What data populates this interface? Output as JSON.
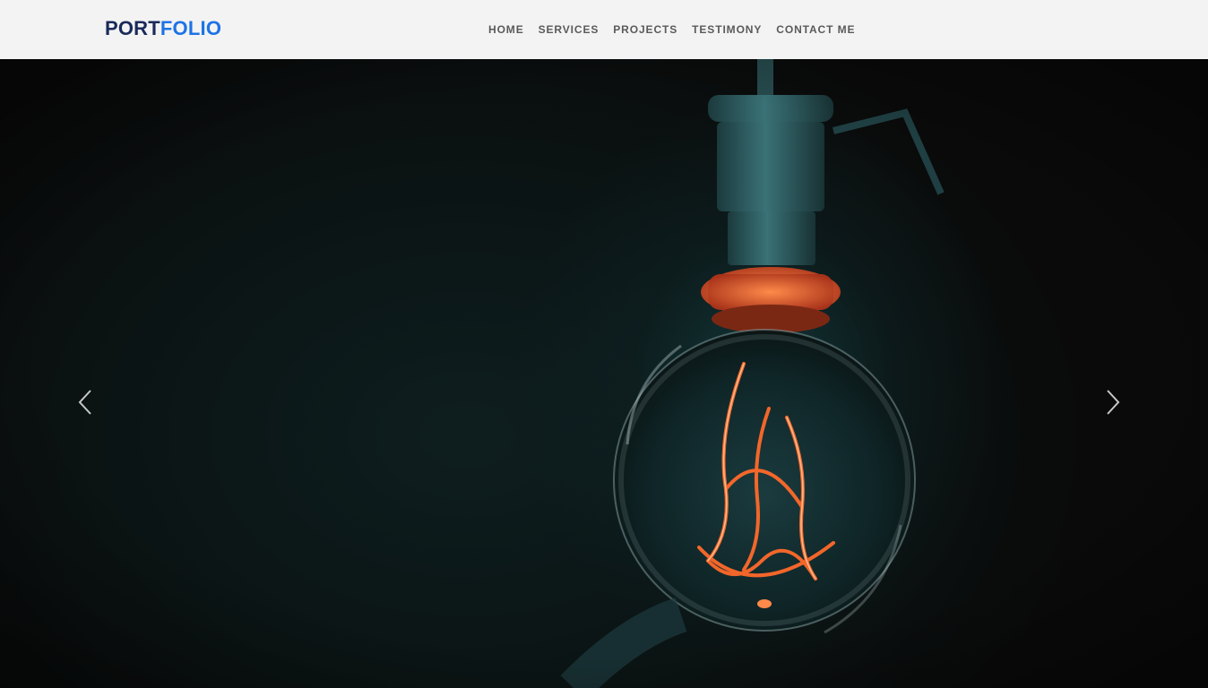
{
  "brand": {
    "part1": "PORT",
    "part2": "FOLIO"
  },
  "nav": {
    "items": [
      {
        "label": "HOME"
      },
      {
        "label": "SERVICES"
      },
      {
        "label": "PROJECTS"
      },
      {
        "label": "TESTIMONY"
      },
      {
        "label": "CONTACT ME"
      }
    ]
  },
  "colors": {
    "brand_dark": "#1a2a5a",
    "brand_accent": "#1e73e6",
    "navbar_bg": "#f3f3f3",
    "filament": "#ff6a2a",
    "socket": "#2f5e62"
  },
  "carousel": {
    "prev_icon": "chevron-left-icon",
    "next_icon": "chevron-right-icon",
    "slide_image": "light-bulb-photo"
  }
}
